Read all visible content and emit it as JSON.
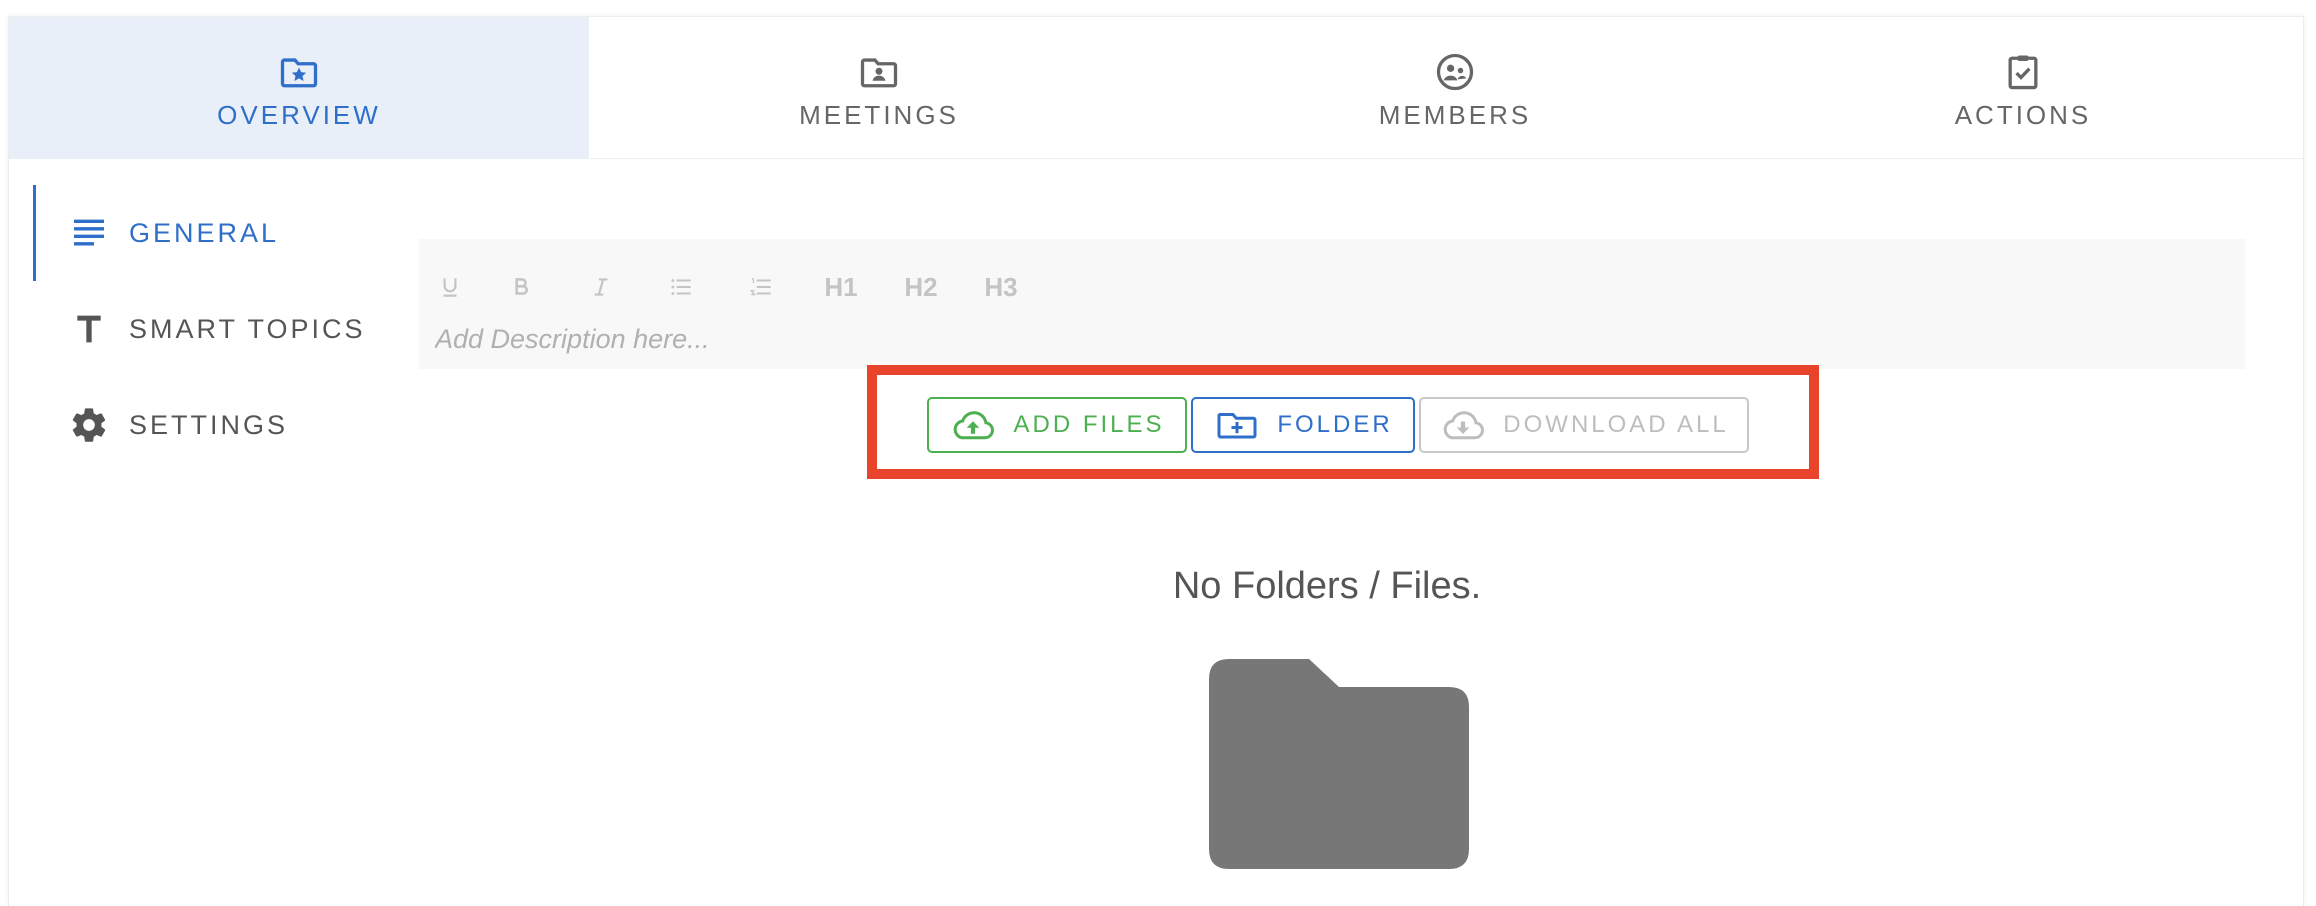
{
  "tabs": [
    {
      "label": "OVERVIEW",
      "icon": "folder-star-icon",
      "active": true
    },
    {
      "label": "MEETINGS",
      "icon": "folder-account-icon",
      "active": false
    },
    {
      "label": "MEMBERS",
      "icon": "account-group-icon",
      "active": false
    },
    {
      "label": "ACTIONS",
      "icon": "clipboard-check-icon",
      "active": false
    }
  ],
  "sidenav": {
    "items": [
      {
        "label": "GENERAL",
        "icon": "text-lines-icon",
        "active": true
      },
      {
        "label": "SMART TOPICS",
        "icon": "letter-t-icon",
        "active": false
      },
      {
        "label": "SETTINGS",
        "icon": "gear-icon",
        "active": false
      }
    ]
  },
  "editor": {
    "toolbar": {
      "underline": "U",
      "bold": "B",
      "italic": "I",
      "h1": "H1",
      "h2": "H2",
      "h3": "H3"
    },
    "placeholder": "Add Description here..."
  },
  "file_actions": {
    "add_files": "ADD FILES",
    "folder": "FOLDER",
    "download_all": "DOWNLOAD ALL"
  },
  "empty_state": {
    "message": "No Folders / Files."
  },
  "colors": {
    "accent": "#2f6ec9",
    "success": "#4caf50",
    "highlight": "#e8432b",
    "active_tab_bg": "#e8eff9"
  }
}
